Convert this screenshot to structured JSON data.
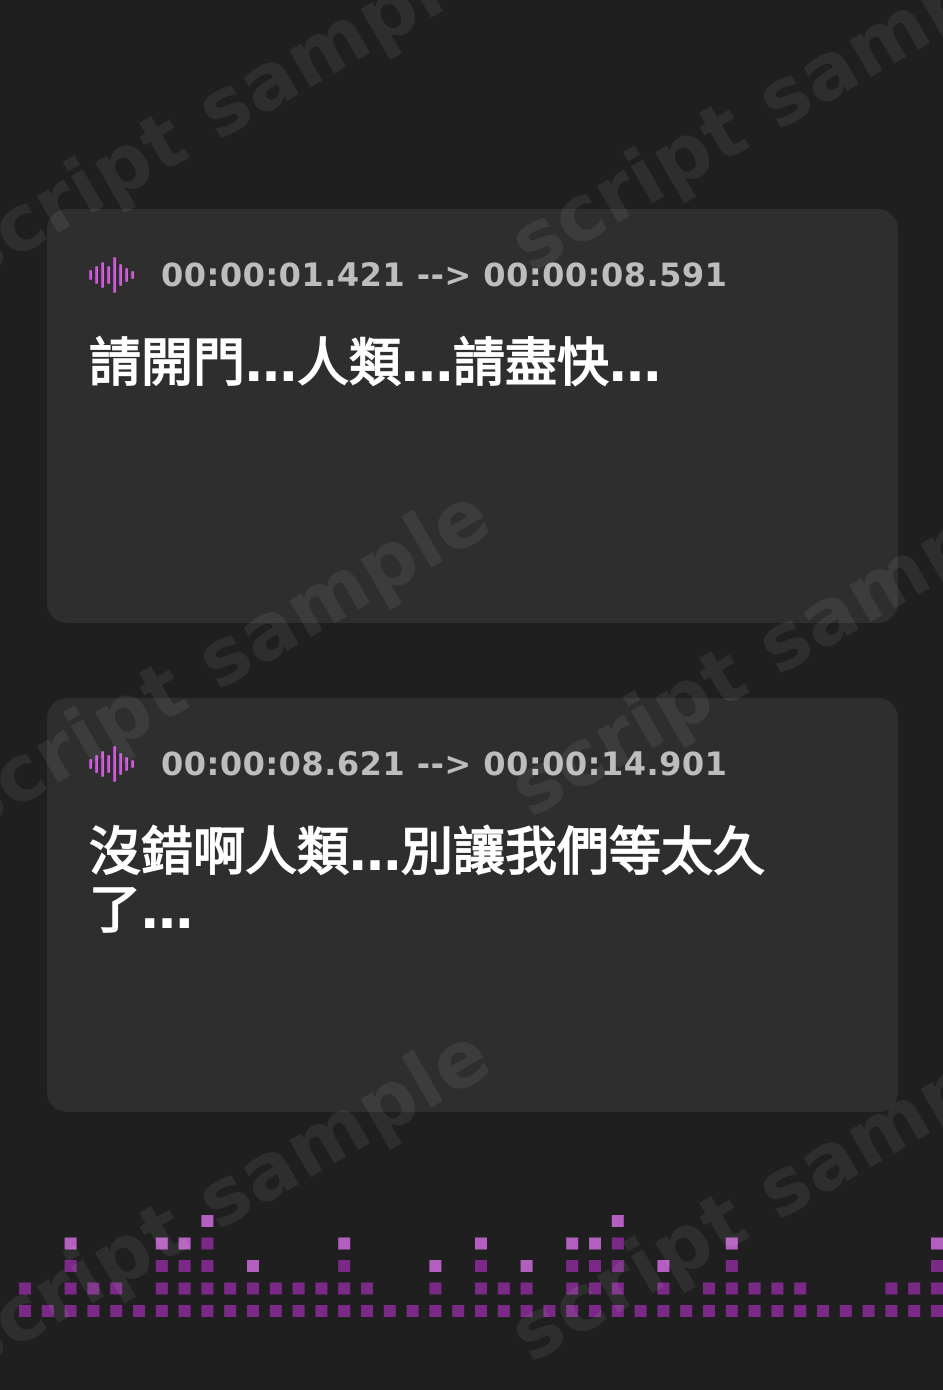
{
  "cues": [
    {
      "timestamp": "00:00:01.421 --> 00:00:08.591",
      "text": "請開門…人類…請盡快…"
    },
    {
      "timestamp": "00:00:08.621 --> 00:00:14.901",
      "text": "沒錯啊人類…別讓我們等太久了…"
    }
  ],
  "watermark_text": "script sample",
  "icons": {
    "cue": "sound-wave-icon"
  },
  "colors": {
    "background": "#1f1f20",
    "card": "#2e2e2f",
    "timestamp_text": "#bdbdbd",
    "subtitle_text": "#ffffff",
    "accent_wave_start": "#a63fd6",
    "accent_wave_end": "#e070c8",
    "equalizer": "#7a2a86"
  },
  "equalizer_levels": [
    2,
    1,
    4,
    2,
    2,
    1,
    4,
    4,
    5,
    2,
    3,
    2,
    2,
    2,
    4,
    2,
    1,
    1,
    3,
    1,
    4,
    2,
    3,
    1,
    4,
    4,
    5,
    1,
    3,
    1,
    2,
    4,
    2,
    2,
    2,
    1,
    1,
    1,
    2,
    2,
    4,
    5,
    1,
    2,
    3,
    1,
    4,
    3,
    3,
    1,
    1,
    1,
    2
  ]
}
